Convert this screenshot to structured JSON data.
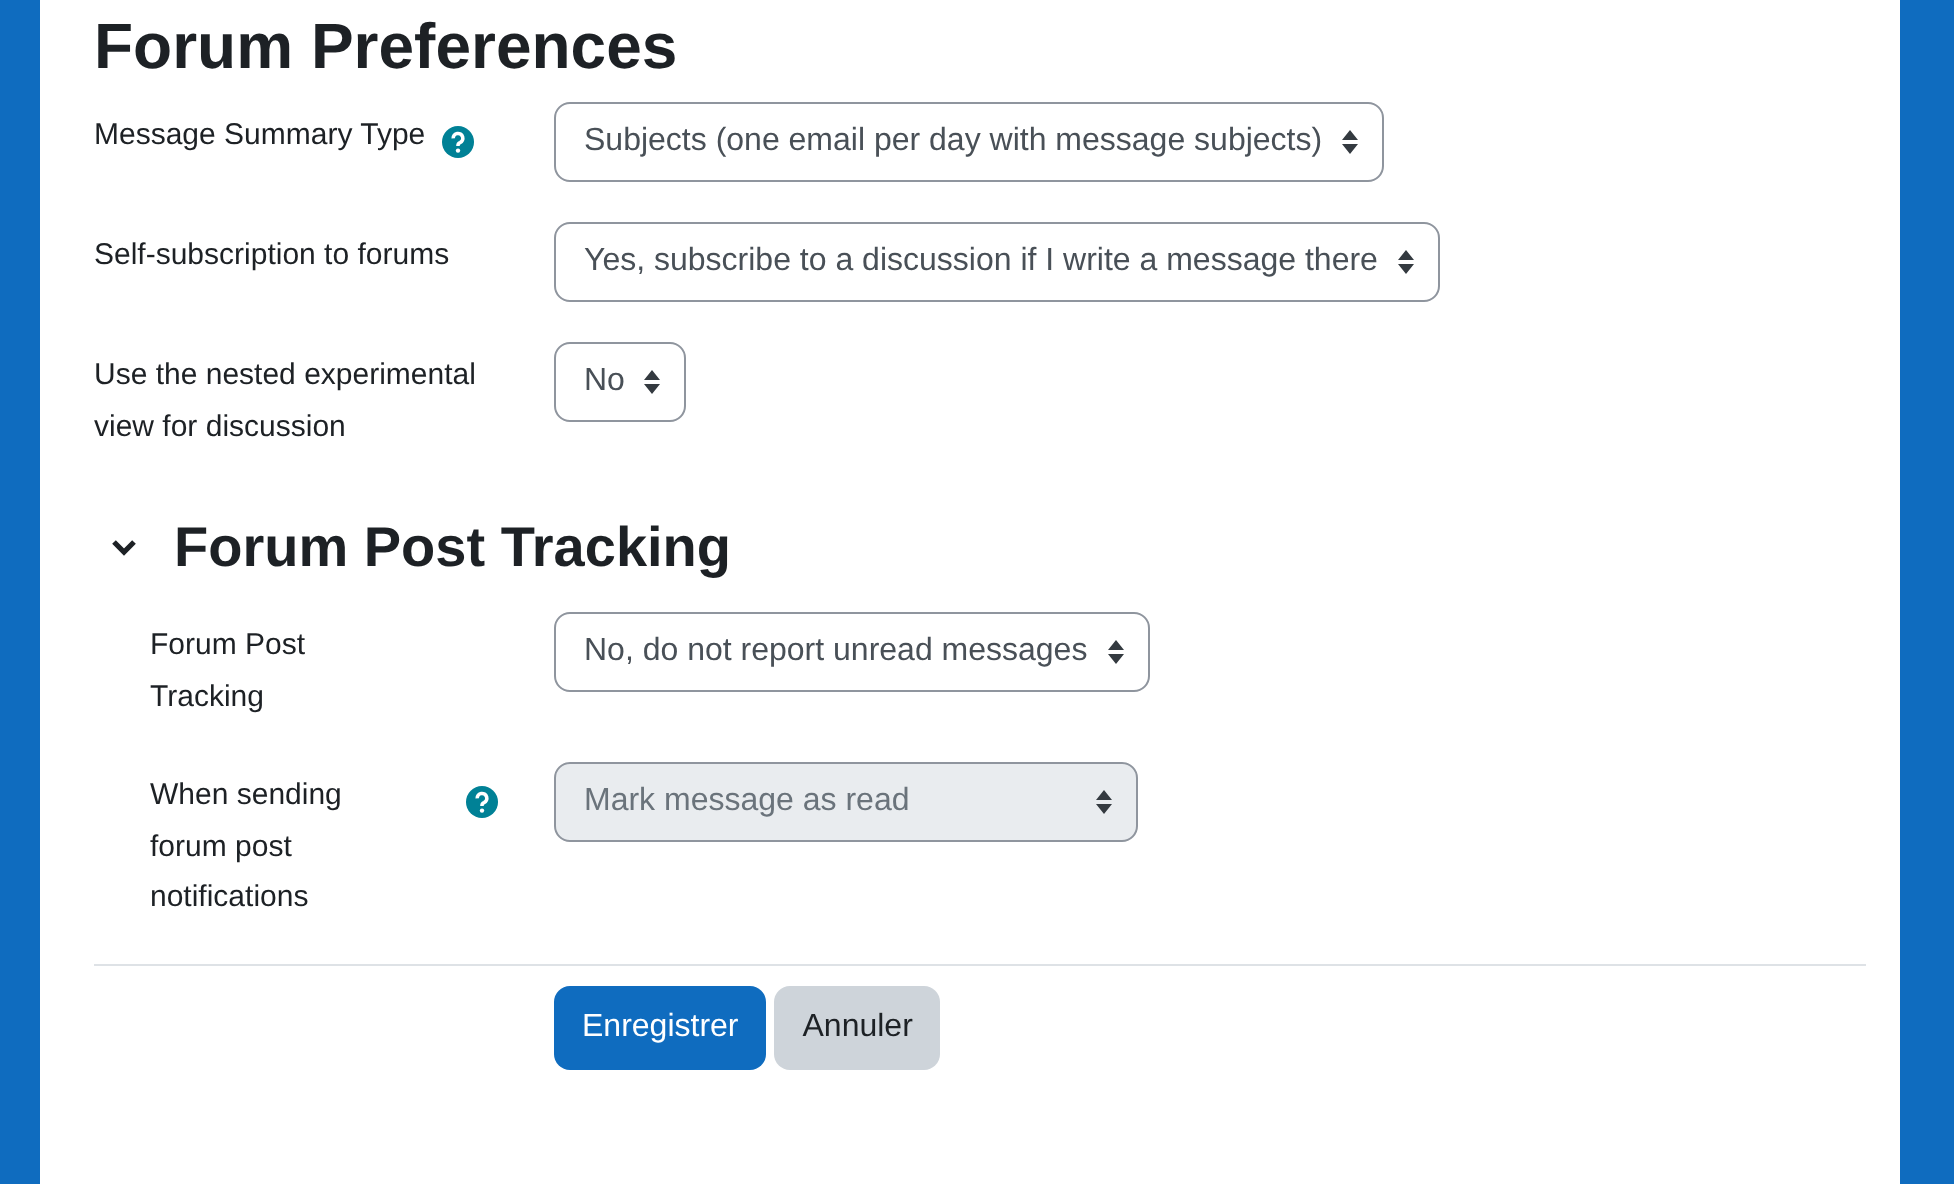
{
  "title": "Forum Preferences",
  "fields": [
    {
      "label": "Message Summary Type",
      "help": true,
      "value": "Subjects (one email per day with message subjects)",
      "disabled": false
    },
    {
      "label": "Self-subscription to forums",
      "help": false,
      "value": "Yes, subscribe to a discussion if I write a message there",
      "disabled": false
    },
    {
      "label": "Use the nested experimental view for discussion",
      "help": false,
      "value": "No",
      "disabled": false
    }
  ],
  "section": {
    "title": "Forum Post Tracking",
    "expanded": true,
    "fields": [
      {
        "label": "Forum Post Tracking",
        "help": false,
        "value": "No, do not report unread messages",
        "disabled": false
      },
      {
        "label": "When sending forum post notifications",
        "help": true,
        "value": "Mark message as read",
        "disabled": true
      }
    ]
  },
  "buttons": [
    {
      "label": "Enregistrer",
      "kind": "primary"
    },
    {
      "label": "Annuler",
      "kind": "secondary"
    }
  ]
}
